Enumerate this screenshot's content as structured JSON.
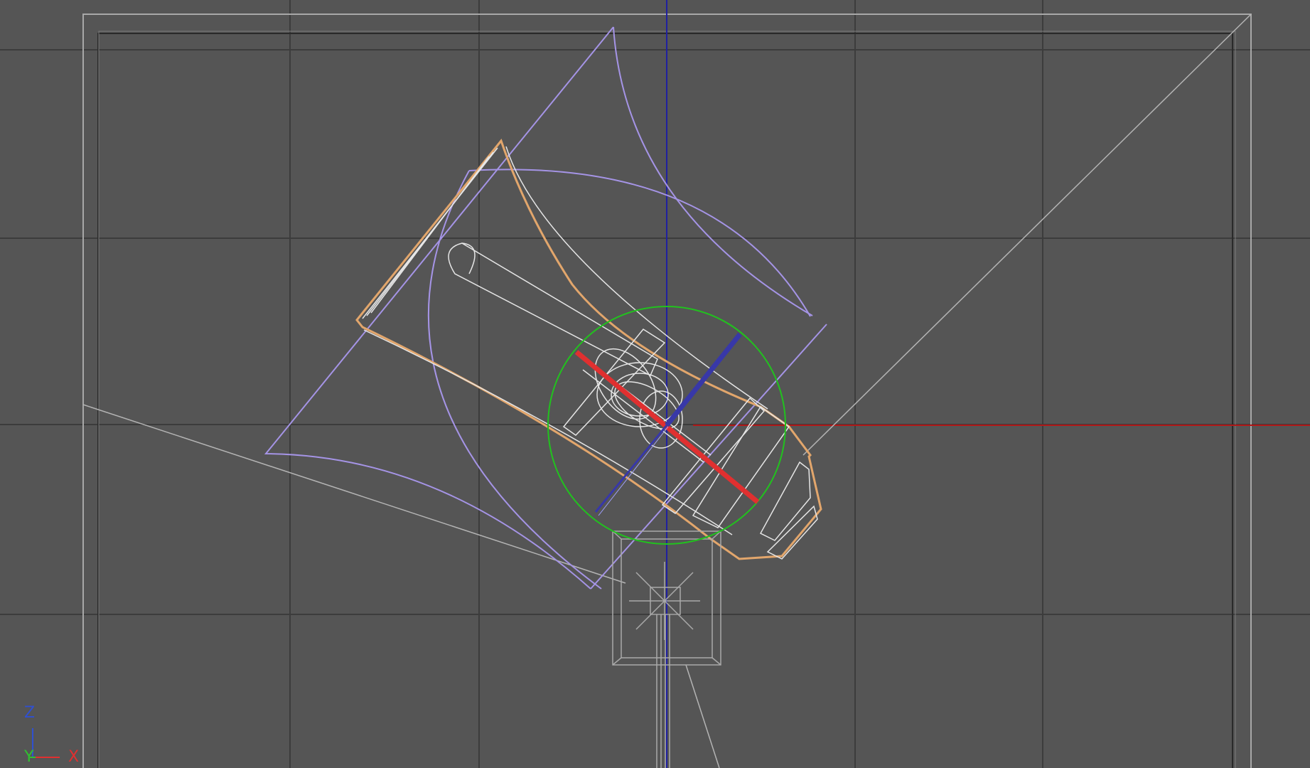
{
  "viewport": {
    "background": "#555555",
    "grid_color": "#3c3c3c",
    "safe_frame_color": "#a8a8a8"
  },
  "gizmo": {
    "z_label": "Z",
    "y_label": "Y",
    "x_label": "X",
    "x_color": "#e03030",
    "y_color": "#30c030",
    "z_color": "#3050d0"
  },
  "scene_colors": {
    "selected_outline": "#e2a66c",
    "wireframe": "#e6e6e6",
    "light_cone": "#a594e6",
    "rotate_gizmo_ring": "#21c21e",
    "world_x_axis": "#b01818",
    "world_z_axis": "#2020a0",
    "light_stand": "#a9a9a9"
  },
  "icons": {
    "axis_tripod": "axis-tripod-icon"
  }
}
